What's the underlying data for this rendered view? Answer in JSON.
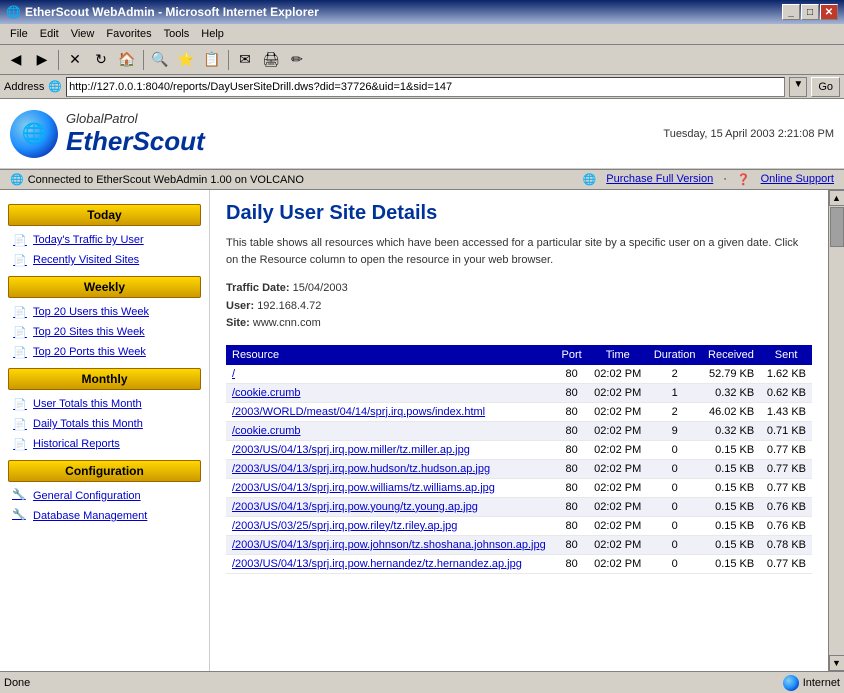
{
  "window": {
    "title": "EtherScout WebAdmin - Microsoft Internet Explorer",
    "controls": [
      "_",
      "□",
      "✕"
    ]
  },
  "menubar": {
    "items": [
      "File",
      "Edit",
      "View",
      "Favorites",
      "Tools",
      "Help"
    ]
  },
  "addressbar": {
    "url": "http://127.0.0.1:8040/reports/DayUserSiteDrill.dws?did=37726&uid=1&sid=147",
    "go": "Go"
  },
  "header": {
    "brand1": "GlobalPatrol",
    "brand2": "EtherScout",
    "datetime": "Tuesday, 15 April 2003 2:21:08 PM"
  },
  "connectedbar": {
    "left": "Connected to EtherScout WebAdmin 1.00 on VOLCANO",
    "link1": "Purchase Full Version",
    "separator": "·",
    "link2": "Online Support"
  },
  "sidebar": {
    "today_header": "Today",
    "today_items": [
      {
        "label": "Today's Traffic by User",
        "icon": "doc"
      },
      {
        "label": "Recently Visited Sites",
        "icon": "doc"
      }
    ],
    "weekly_header": "Weekly",
    "weekly_items": [
      {
        "label": "Top 20 Users this Week",
        "icon": "doc"
      },
      {
        "label": "Top 20 Sites this Week",
        "icon": "doc"
      },
      {
        "label": "Top 20 Ports this Week",
        "icon": "doc"
      }
    ],
    "monthly_header": "Monthly",
    "monthly_items": [
      {
        "label": "User Totals this Month",
        "icon": "doc"
      },
      {
        "label": "Daily Totals this Month",
        "icon": "doc"
      },
      {
        "label": "Historical Reports",
        "icon": "doc"
      }
    ],
    "config_header": "Configuration",
    "config_items": [
      {
        "label": "General Configuration",
        "icon": "gear"
      },
      {
        "label": "Database Management",
        "icon": "gear"
      }
    ]
  },
  "main": {
    "title": "Daily User Site Details",
    "description": "This table shows all resources which have been accessed for a particular site by a specific user on a given date. Click on the Resource column to open the resource in your web browser.",
    "traffic_date_label": "Traffic Date:",
    "traffic_date_value": "15/04/2003",
    "user_label": "User:",
    "user_value": "192.168.4.72",
    "site_label": "Site:",
    "site_value": "www.cnn.com",
    "table": {
      "columns": [
        "Resource",
        "Port",
        "Time",
        "Duration",
        "Received",
        "Sent"
      ],
      "rows": [
        {
          "resource": "/",
          "port": "80",
          "time": "02:02 PM",
          "duration": "2",
          "received": "52.79 KB",
          "sent": "1.62 KB"
        },
        {
          "resource": "/cookie.crumb",
          "port": "80",
          "time": "02:02 PM",
          "duration": "1",
          "received": "0.32 KB",
          "sent": "0.62 KB"
        },
        {
          "resource": "/2003/WORLD/meast/04/14/sprj.irq.pows/index.html",
          "port": "80",
          "time": "02:02 PM",
          "duration": "2",
          "received": "46.02 KB",
          "sent": "1.43 KB"
        },
        {
          "resource": "/cookie.crumb",
          "port": "80",
          "time": "02:02 PM",
          "duration": "9",
          "received": "0.32 KB",
          "sent": "0.71 KB"
        },
        {
          "resource": "/2003/US/04/13/sprj.irq.pow.miller/tz.miller.ap.jpg",
          "port": "80",
          "time": "02:02 PM",
          "duration": "0",
          "received": "0.15 KB",
          "sent": "0.77 KB"
        },
        {
          "resource": "/2003/US/04/13/sprj.irq.pow.hudson/tz.hudson.ap.jpg",
          "port": "80",
          "time": "02:02 PM",
          "duration": "0",
          "received": "0.15 KB",
          "sent": "0.77 KB"
        },
        {
          "resource": "/2003/US/04/13/sprj.irq.pow.williams/tz.williams.ap.jpg",
          "port": "80",
          "time": "02:02 PM",
          "duration": "0",
          "received": "0.15 KB",
          "sent": "0.77 KB"
        },
        {
          "resource": "/2003/US/04/13/sprj.irq.pow.young/tz.young.ap.jpg",
          "port": "80",
          "time": "02:02 PM",
          "duration": "0",
          "received": "0.15 KB",
          "sent": "0.76 KB"
        },
        {
          "resource": "/2003/US/03/25/sprj.irq.pow.riley/tz.riley.ap.jpg",
          "port": "80",
          "time": "02:02 PM",
          "duration": "0",
          "received": "0.15 KB",
          "sent": "0.76 KB"
        },
        {
          "resource": "/2003/US/04/13/sprj.irq.pow.johnson/tz.shoshana.johnson.ap.jpg",
          "port": "80",
          "time": "02:02 PM",
          "duration": "0",
          "received": "0.15 KB",
          "sent": "0.78 KB"
        },
        {
          "resource": "/2003/US/04/13/sprj.irq.pow.hernandez/tz.hernandez.ap.jpg",
          "port": "80",
          "time": "02:02 PM",
          "duration": "0",
          "received": "0.15 KB",
          "sent": "0.77 KB"
        }
      ]
    }
  },
  "statusbar": {
    "left": "Done",
    "right": "Internet"
  }
}
